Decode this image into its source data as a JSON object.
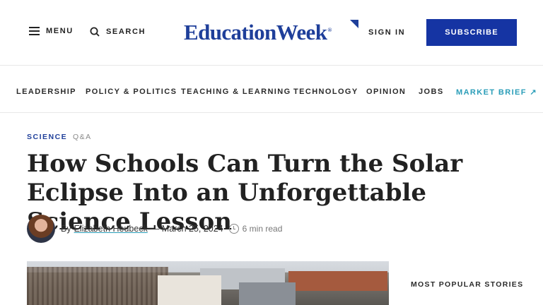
{
  "header": {
    "menu_label": "MENU",
    "search_label": "SEARCH",
    "logo_text": "EducationWeek",
    "logo_mark": "®",
    "signin_label": "SIGN IN",
    "subscribe_label": "SUBSCRIBE"
  },
  "nav": {
    "items": [
      "LEADERSHIP",
      "POLICY & POLITICS",
      "TEACHING & LEARNING",
      "TECHNOLOGY",
      "OPINION",
      "JOBS"
    ],
    "market_label": "MARKET BRIEF ↗"
  },
  "article": {
    "kicker": "SCIENCE",
    "kicker_secondary": "Q&A",
    "headline": "How Schools Can Turn the Solar Eclipse Into an Unforgettable Science Lesson",
    "by": "By",
    "author": "Elizabeth Heubeck",
    "date": "— March 25, 2024",
    "read_time": "6 min read"
  },
  "sidebar": {
    "popular_title": "MOST POPULAR STORIES"
  },
  "colors": {
    "brand": "#1f3f9a",
    "subscribe_bg": "#1534a3",
    "accent": "#2a9db8"
  },
  "icons": [
    "menu-icon",
    "search-icon",
    "clock-icon",
    "external-arrow-icon"
  ]
}
